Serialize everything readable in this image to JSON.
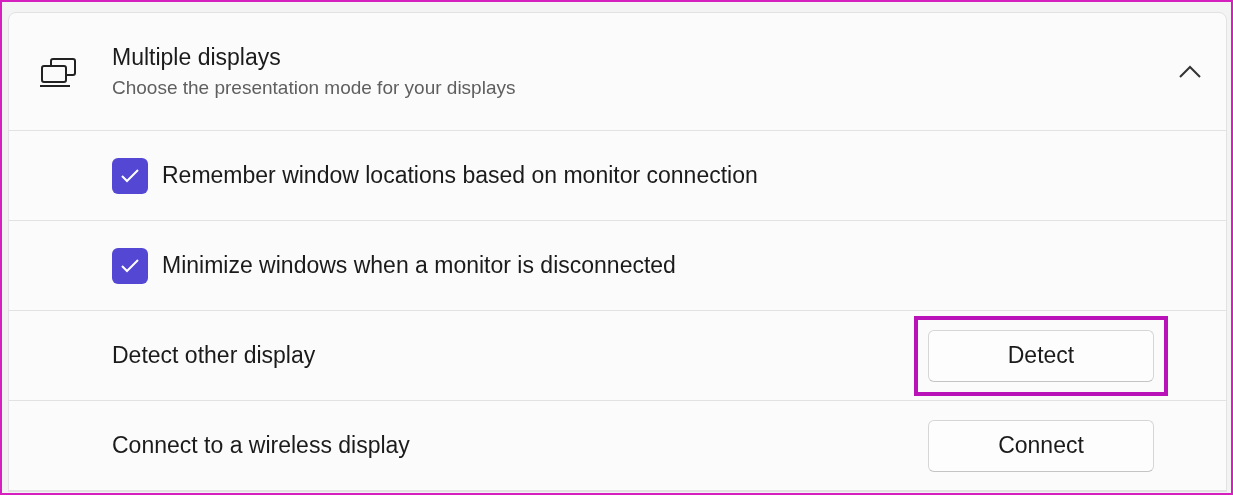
{
  "section": {
    "title": "Multiple displays",
    "subtitle": "Choose the presentation mode for your displays",
    "expanded": true
  },
  "rows": [
    {
      "kind": "checkbox",
      "label": "Remember window locations based on monitor connection",
      "checked": true
    },
    {
      "kind": "checkbox",
      "label": "Minimize windows when a monitor is disconnected",
      "checked": true
    },
    {
      "kind": "button",
      "label": "Detect other display",
      "button": "Detect",
      "highlighted": true
    },
    {
      "kind": "button",
      "label": "Connect to a wireless display",
      "button": "Connect",
      "highlighted": false
    }
  ]
}
